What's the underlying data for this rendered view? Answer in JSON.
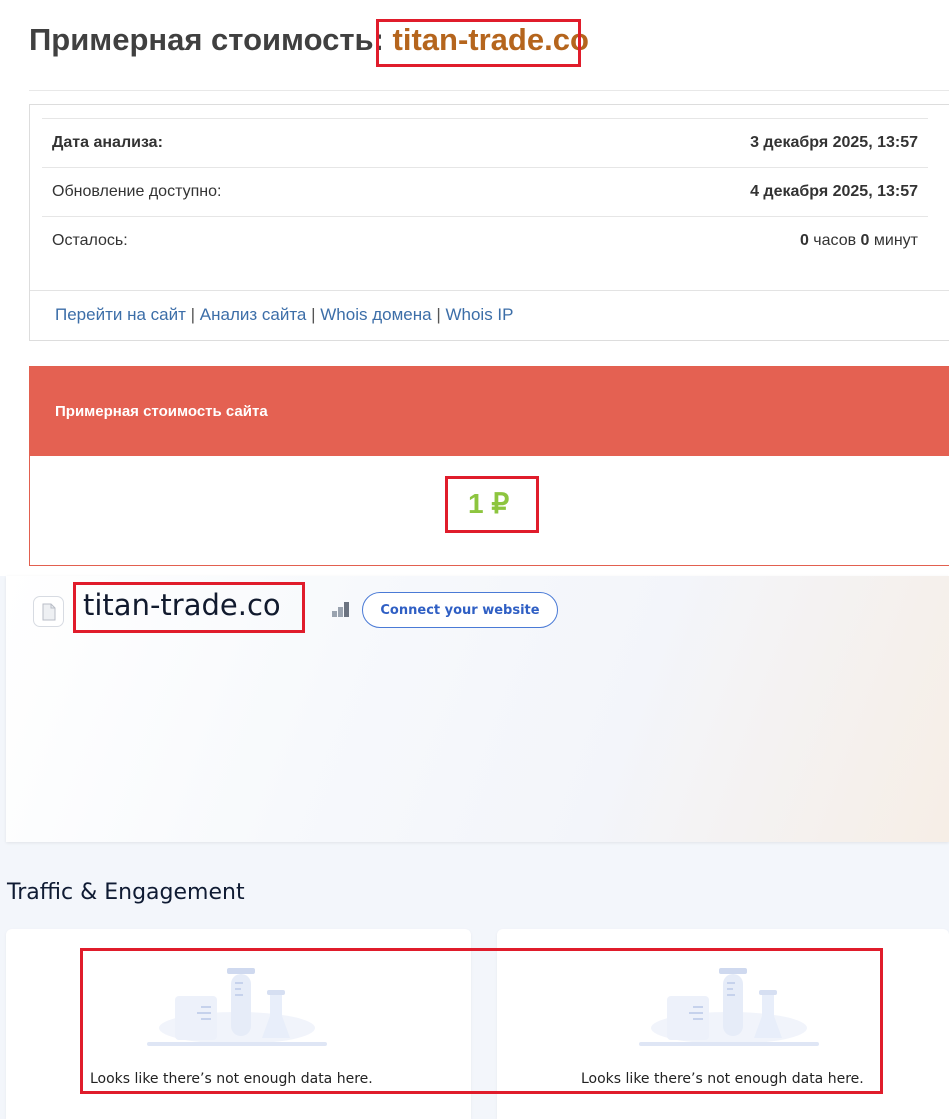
{
  "header": {
    "title_prefix": "Примерная стоимость: ",
    "title_domain": "titan-trade.co"
  },
  "info": {
    "rows": [
      {
        "label": "Дата анализа:",
        "value": "3 декабря 2025, 13:57"
      },
      {
        "label": "Обновление доступно:",
        "value": "4 декабря 2025, 13:57"
      },
      {
        "label": "Осталось:",
        "hours": "0",
        "hours_unit": " часов ",
        "minutes": "0",
        "minutes_unit": " минут"
      }
    ],
    "links": [
      {
        "label": "Перейти на сайт"
      },
      {
        "label": "Анализ сайта"
      },
      {
        "label": "Whois домена"
      },
      {
        "label": "Whois IP"
      }
    ],
    "separator": " | "
  },
  "valuation": {
    "heading": "Примерная стоимость сайта",
    "amount": "1 ₽"
  },
  "widget": {
    "site_name": "titan-trade.co",
    "connect_label": "Connect your website",
    "section_title": "Traffic & Engagement",
    "empty_left": "Looks like there’s not enough data here.",
    "empty_right": "Looks like there’s not enough data here."
  },
  "icons": {
    "file": "file-icon",
    "signal": "signal-bars-icon",
    "empty_state": "lab-flask-illustration"
  },
  "colors": {
    "domain_accent": "#b5651d",
    "highlight_box": "#e01c2b",
    "valuation_header": "#e46152",
    "amount_green": "#8dc53f",
    "link_blue": "#3c6ea8",
    "connect_blue": "#2f5fc4"
  }
}
